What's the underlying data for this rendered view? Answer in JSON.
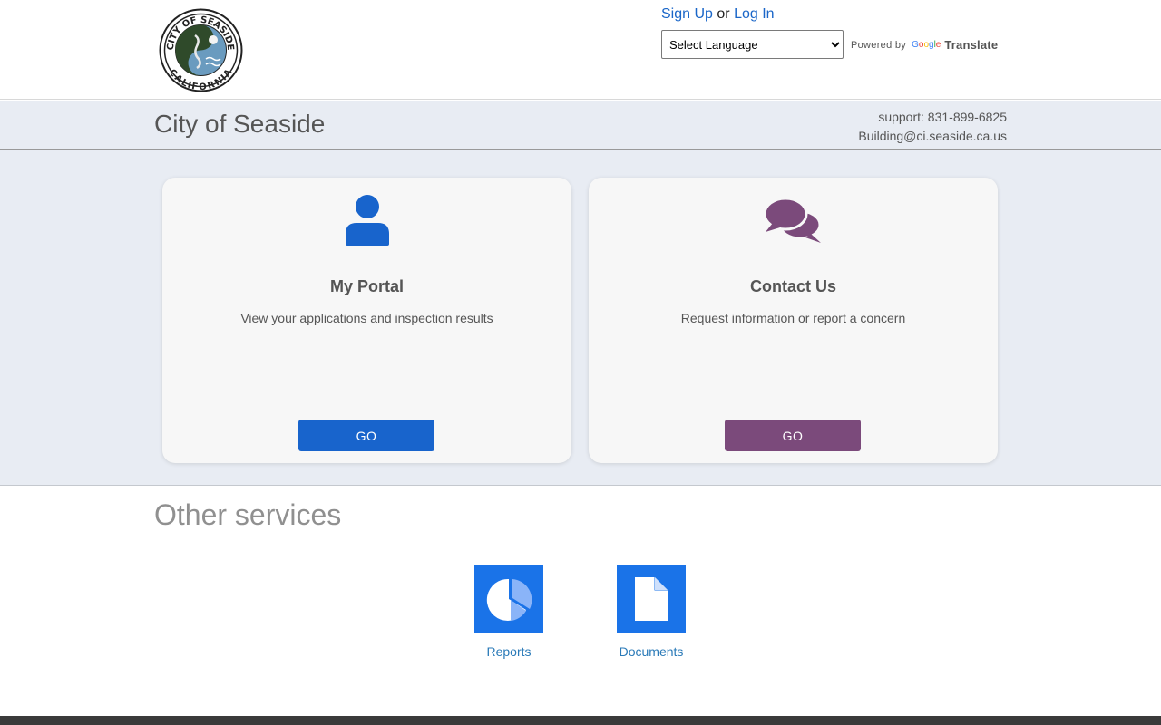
{
  "header": {
    "logo_text_top": "CITY OF SEASIDE",
    "logo_text_bottom": "CALIFORNIA",
    "sign_up": "Sign Up",
    "or": "or",
    "log_in": "Log In",
    "language_select": "Select Language",
    "powered_by": "Powered by",
    "google": "Google",
    "translate": "Translate"
  },
  "titleband": {
    "title": "City of Seaside",
    "support_phone": "support: 831-899-6825",
    "support_email": "Building@ci.seaside.ca.us"
  },
  "cards": [
    {
      "title": "My Portal",
      "description": "View your applications and inspection results",
      "button": "GO",
      "icon": "person-icon",
      "color": "#1864cc"
    },
    {
      "title": "Contact Us",
      "description": "Request information or report a concern",
      "button": "GO",
      "icon": "chat-bubbles-icon",
      "color": "#7b4a7b"
    }
  ],
  "other_services": {
    "title": "Other services",
    "items": [
      {
        "label": "Reports",
        "icon": "pie-chart-icon"
      },
      {
        "label": "Documents",
        "icon": "document-icon"
      }
    ]
  }
}
